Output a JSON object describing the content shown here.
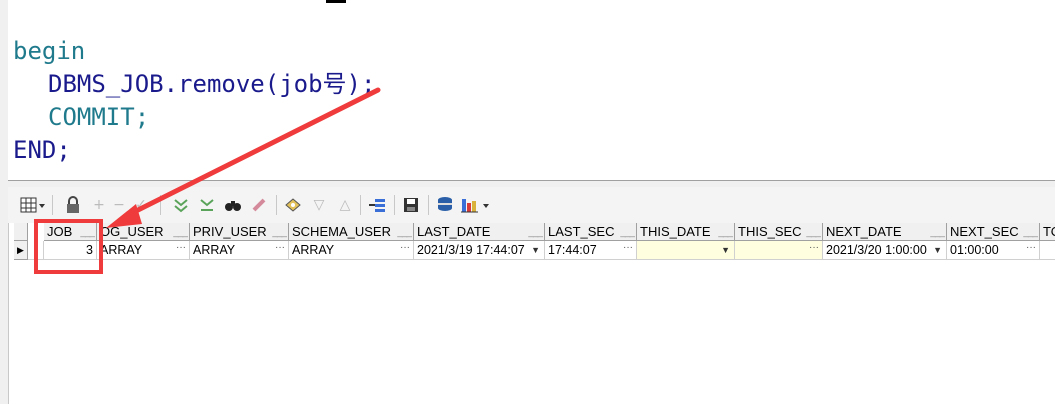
{
  "editor": {
    "lines": [
      "begin",
      "  DBMS_JOB.remove(job号);",
      "  COMMIT;",
      "END;"
    ],
    "kw_begin": "begin",
    "line2_ident": "DBMS_JOB.remove(job号);",
    "kw_commit": "COMMIT;",
    "kw_end": "END;"
  },
  "toolbar": {
    "icons": [
      "grid-view-icon",
      "lock-icon",
      "add-icon",
      "delete-icon",
      "apply-icon",
      "apply-all-icon",
      "find-icon",
      "clear-icon",
      "fetch-icon",
      "prev-icon",
      "next-icon",
      "query-by-example-icon",
      "save-icon",
      "export-icon",
      "chart-icon"
    ]
  },
  "grid": {
    "columns": [
      "JOB",
      "LOG_USER",
      "PRIV_USER",
      "SCHEMA_USER",
      "LAST_DATE",
      "LAST_SEC",
      "THIS_DATE",
      "THIS_SEC",
      "NEXT_DATE",
      "NEXT_SEC",
      "TO"
    ],
    "header_labels": {
      "job": "JOB",
      "log_user": "OG_USER",
      "priv_user": "PRIV_USER",
      "schema_user": "SCHEMA_USER",
      "last_date": "LAST_DATE",
      "last_sec": "LAST_SEC",
      "this_date": "THIS_DATE",
      "this_sec": "THIS_SEC",
      "next_date": "NEXT_DATE",
      "next_sec": "NEXT_SEC",
      "total": "TO"
    },
    "row": {
      "job": "3",
      "log_user": "ARRAY",
      "priv_user": "ARRAY",
      "schema_user": "ARRAY",
      "last_date": "2021/3/19 17:44:07",
      "last_sec": "17:44:07",
      "this_date": "",
      "this_sec": "",
      "next_date": "2021/3/20 1:00:00",
      "next_sec": "01:00:00",
      "total": ""
    }
  },
  "colors": {
    "annotation": "#ef3b3b",
    "keyword": "#1f7a8c",
    "identifier": "#1a1a8c",
    "null_cell": "#ffffe0"
  }
}
